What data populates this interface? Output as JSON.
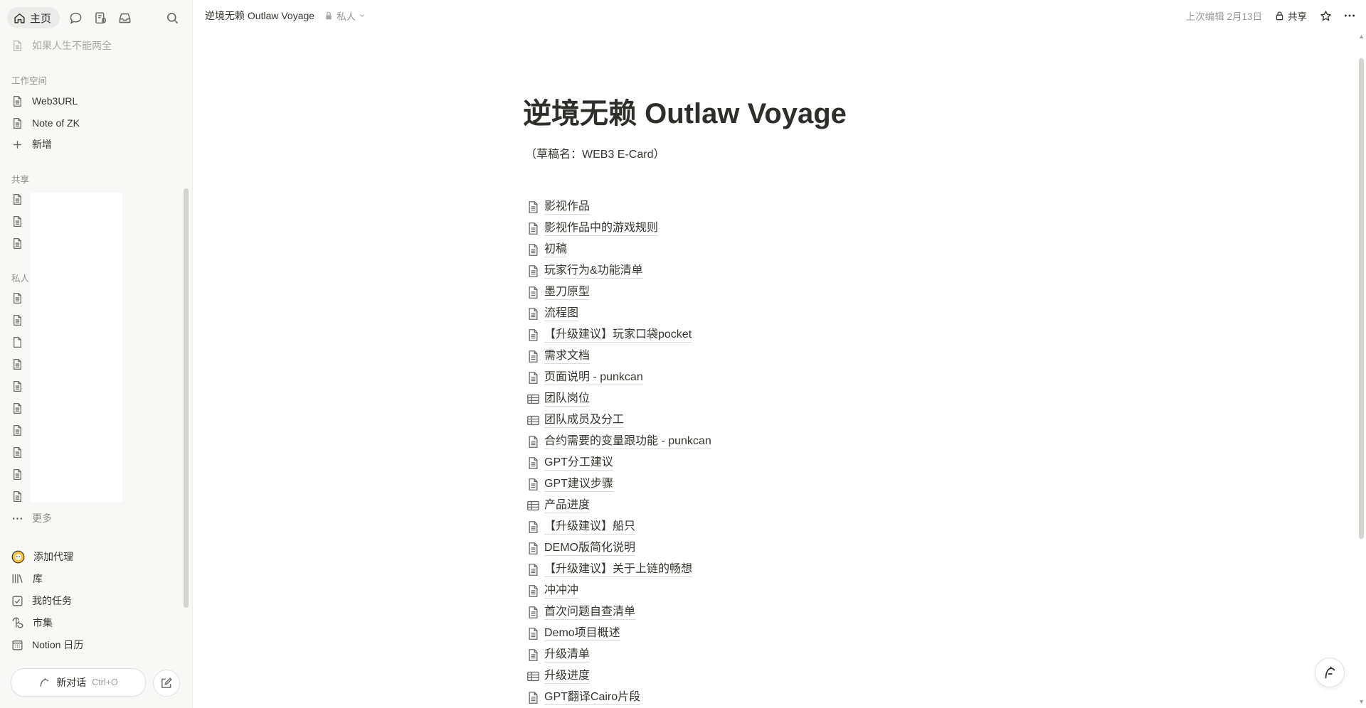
{
  "sidebar": {
    "home_label": "主页",
    "faded_item": "如果人生不能两全",
    "workspace_title": "工作空间",
    "workspace_items": [
      "Web3URL",
      "Note of ZK"
    ],
    "add_label": "新增",
    "shared_title": "共享",
    "private_title": "私人",
    "more_label": "更多",
    "tools": [
      {
        "label": "添加代理",
        "icon": "agent-icon"
      },
      {
        "label": "库",
        "icon": "library-icon"
      },
      {
        "label": "我的任务",
        "icon": "checkbox-icon"
      },
      {
        "label": "市集",
        "icon": "marketplace-icon"
      },
      {
        "label": "Notion 日历",
        "icon": "calendar-icon"
      }
    ],
    "new_chat_label": "新对话",
    "new_chat_shortcut": "Ctrl+O"
  },
  "topbar": {
    "breadcrumb_title": "逆境无赖 Outlaw Voyage",
    "privacy_label": "私人",
    "last_edited": "上次编辑 2月13日",
    "share_label": "共享"
  },
  "page": {
    "title": "逆境无赖 Outlaw Voyage",
    "subtitle": "（草稿名：WEB3 E-Card）",
    "items": [
      {
        "label": "影视作品",
        "icon": "page-icon"
      },
      {
        "label": "影视作品中的游戏规则",
        "icon": "page-icon"
      },
      {
        "label": "初稿",
        "icon": "page-icon"
      },
      {
        "label": "玩家行为&功能清单",
        "icon": "page-icon"
      },
      {
        "label": "墨刀原型",
        "icon": "page-icon"
      },
      {
        "label": "流程图",
        "icon": "page-icon"
      },
      {
        "label": "【升级建议】玩家口袋pocket",
        "icon": "page-icon"
      },
      {
        "label": "需求文档",
        "icon": "page-icon"
      },
      {
        "label": "页面说明 - punkcan",
        "icon": "page-icon"
      },
      {
        "label": "团队岗位",
        "icon": "table-icon"
      },
      {
        "label": "团队成员及分工",
        "icon": "table-icon"
      },
      {
        "label": "合约需要的变量跟功能 - punkcan",
        "icon": "page-icon"
      },
      {
        "label": "GPT分工建议",
        "icon": "page-icon"
      },
      {
        "label": "GPT建议步骤",
        "icon": "page-icon"
      },
      {
        "label": "产品进度",
        "icon": "table-icon"
      },
      {
        "label": "【升级建议】船只",
        "icon": "page-icon"
      },
      {
        "label": "DEMO版简化说明",
        "icon": "page-icon"
      },
      {
        "label": "【升级建议】关于上链的畅想",
        "icon": "page-icon"
      },
      {
        "label": "冲冲冲",
        "icon": "page-icon"
      },
      {
        "label": "首次问题自查清单",
        "icon": "page-icon"
      },
      {
        "label": "Demo项目概述",
        "icon": "page-icon"
      },
      {
        "label": "升级清单",
        "icon": "page-icon"
      },
      {
        "label": "升级进度",
        "icon": "table-icon"
      },
      {
        "label": "GPT翻译Cairo片段",
        "icon": "page-icon"
      }
    ]
  },
  "colors": {
    "sidebar_bg": "#f8f8f7",
    "text": "#37352f",
    "muted": "#9b9a97"
  }
}
